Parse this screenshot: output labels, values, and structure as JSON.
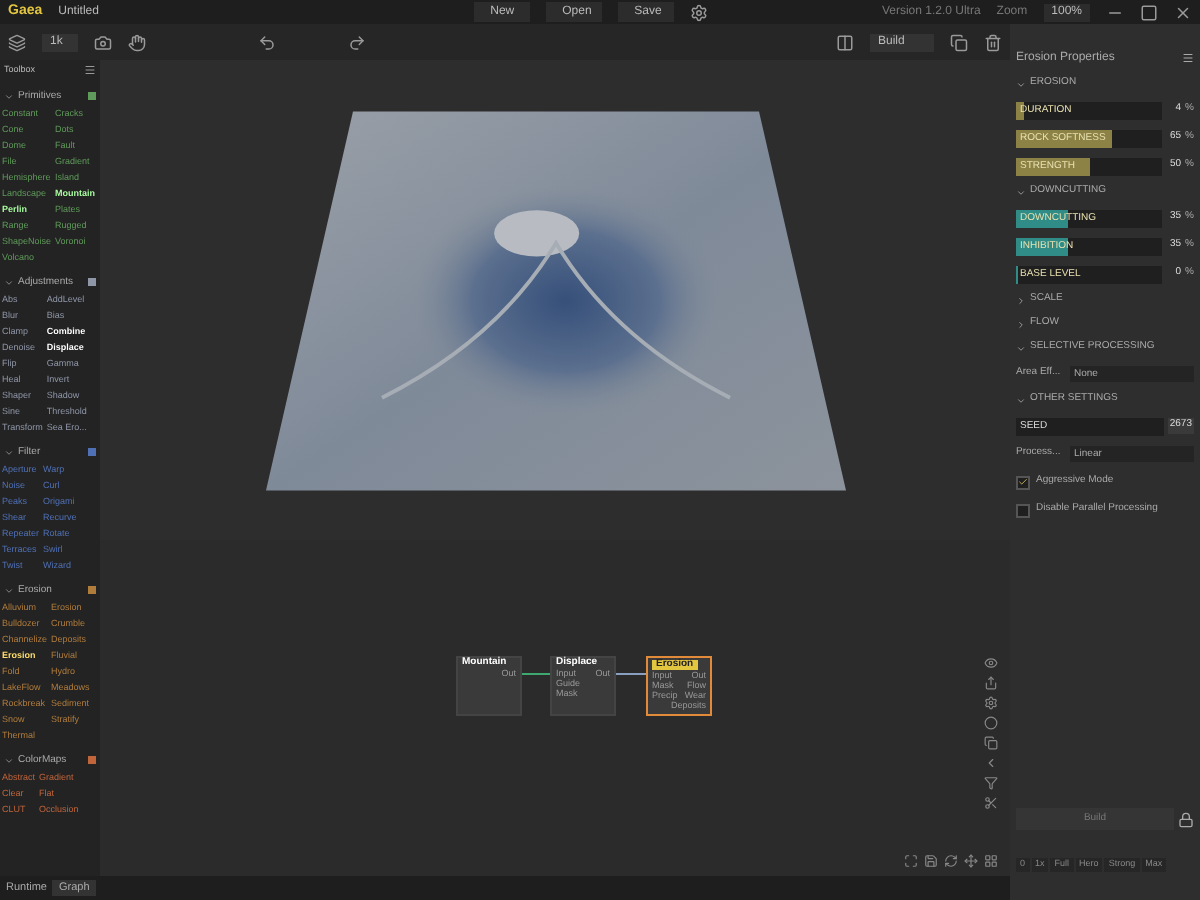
{
  "title_bar": {
    "app_name": "Gaea",
    "document": "Untitled",
    "buttons": [
      "New",
      "Open",
      "Save"
    ],
    "version": "Version 1.2.0 Ultra",
    "zoom_label": "Zoom",
    "zoom_value": "100%"
  },
  "toolbar": {
    "resolution": "1k",
    "view_mode": "Build"
  },
  "toolbox": {
    "title": "Toolbox",
    "sections": [
      {
        "name": "Primitives",
        "color": "#5f9a5a",
        "items": [
          {
            "label": "Constant",
            "in_use": false
          },
          {
            "label": "Cracks",
            "in_use": false
          },
          {
            "label": "Cone",
            "in_use": false
          },
          {
            "label": "Dots",
            "in_use": false
          },
          {
            "label": "Dome",
            "in_use": false
          },
          {
            "label": "Fault",
            "in_use": false
          },
          {
            "label": "File",
            "in_use": false
          },
          {
            "label": "Gradient",
            "in_use": false
          },
          {
            "label": "Hemisphere",
            "in_use": false
          },
          {
            "label": "Island",
            "in_use": false
          },
          {
            "label": "Landscape",
            "in_use": false
          },
          {
            "label": "Mountain",
            "in_use": true
          },
          {
            "label": "Perlin",
            "in_use": true
          },
          {
            "label": "Plates",
            "in_use": false
          },
          {
            "label": "Range",
            "in_use": false
          },
          {
            "label": "Rugged",
            "in_use": false
          },
          {
            "label": "ShapeNoise",
            "in_use": false
          },
          {
            "label": "Voronoi",
            "in_use": false
          },
          {
            "label": "Volcano",
            "in_use": false
          }
        ]
      },
      {
        "name": "Adjustments",
        "color": "#8f96a8",
        "items": [
          {
            "label": "Abs",
            "in_use": false
          },
          {
            "label": "AddLevel",
            "in_use": false
          },
          {
            "label": "Blur",
            "in_use": false
          },
          {
            "label": "Bias",
            "in_use": false
          },
          {
            "label": "Clamp",
            "in_use": false
          },
          {
            "label": "Combine",
            "in_use": true
          },
          {
            "label": "Denoise",
            "in_use": false
          },
          {
            "label": "Displace",
            "in_use": true
          },
          {
            "label": "Flip",
            "in_use": false
          },
          {
            "label": "Gamma",
            "in_use": false
          },
          {
            "label": "Heal",
            "in_use": false
          },
          {
            "label": "Invert",
            "in_use": false
          },
          {
            "label": "Shaper",
            "in_use": false
          },
          {
            "label": "Shadow",
            "in_use": false
          },
          {
            "label": "Sine",
            "in_use": false
          },
          {
            "label": "Threshold",
            "in_use": false
          },
          {
            "label": "Transform",
            "in_use": false
          },
          {
            "label": "Sea Ero...",
            "in_use": false
          }
        ]
      },
      {
        "name": "Filter",
        "color": "#4f70b5",
        "items": [
          {
            "label": "Aperture",
            "in_use": false
          },
          {
            "label": "Warp",
            "in_use": false
          },
          {
            "label": "Noise",
            "in_use": false
          },
          {
            "label": "Curl",
            "in_use": false
          },
          {
            "label": "Peaks",
            "in_use": false
          },
          {
            "label": "Origami",
            "in_use": false
          },
          {
            "label": "Shear",
            "in_use": false
          },
          {
            "label": "Recurve",
            "in_use": false
          },
          {
            "label": "Repeater",
            "in_use": false
          },
          {
            "label": "Rotate",
            "in_use": false
          },
          {
            "label": "Terraces",
            "in_use": false
          },
          {
            "label": "Swirl",
            "in_use": false
          },
          {
            "label": "Twist",
            "in_use": false
          },
          {
            "label": "Wizard",
            "in_use": false
          }
        ]
      },
      {
        "name": "Erosion",
        "color": "#b07c3c",
        "items": [
          {
            "label": "Alluvium",
            "in_use": false
          },
          {
            "label": "Erosion",
            "in_use": false
          },
          {
            "label": "Bulldozer",
            "in_use": false
          },
          {
            "label": "Crumble",
            "in_use": false
          },
          {
            "label": "Channelize",
            "in_use": false
          },
          {
            "label": "Deposits",
            "in_use": false
          },
          {
            "label": "Erosion",
            "in_use": true
          },
          {
            "label": "Fluvial",
            "in_use": false
          },
          {
            "label": "Fold",
            "in_use": false
          },
          {
            "label": "Hydro",
            "in_use": false
          },
          {
            "label": "LakeFlow",
            "in_use": false
          },
          {
            "label": "Meadows",
            "in_use": false
          },
          {
            "label": "Rockbreak",
            "in_use": false
          },
          {
            "label": "Sediment",
            "in_use": false
          },
          {
            "label": "Snow",
            "in_use": false
          },
          {
            "label": "Stratify",
            "in_use": false
          },
          {
            "label": "Thermal",
            "in_use": false
          }
        ]
      },
      {
        "name": "ColorMaps",
        "color": "#c0643a",
        "items": [
          {
            "label": "Abstract",
            "in_use": false
          },
          {
            "label": "Gradient",
            "in_use": false
          },
          {
            "label": "Clear",
            "in_use": false
          },
          {
            "label": "Flat",
            "in_use": false
          },
          {
            "label": "CLUT",
            "in_use": false
          },
          {
            "label": "Occlusion",
            "in_use": false
          }
        ]
      }
    ]
  },
  "graph": {
    "nodes": [
      {
        "title": "Mountain",
        "selected": false,
        "outputs": [
          "Out"
        ]
      },
      {
        "title": "Displace",
        "selected": false,
        "inputs": [
          "Input",
          "Guide",
          "Mask"
        ],
        "outputs": [
          "Out"
        ]
      },
      {
        "title": "Erosion",
        "selected": true,
        "inputs": [
          "Input",
          "Mask",
          "Precip"
        ],
        "outputs": [
          "Out",
          "Flow",
          "Wear",
          "Deposits"
        ]
      }
    ]
  },
  "status_bar": {
    "label": "Runtime",
    "value": "Graph"
  },
  "properties": {
    "title": "Erosion Properties",
    "sections": [
      {
        "name": "EROSION",
        "expanded": true,
        "color": "#8c8246",
        "sliders": [
          {
            "label": "DURATION",
            "level": 0.04,
            "value": "4",
            "unit": "%"
          },
          {
            "label": "ROCK SOFTNESS",
            "level": 0.65,
            "value": "65",
            "unit": "%"
          },
          {
            "label": "STRENGTH",
            "level": 0.5,
            "value": "50",
            "unit": "%"
          }
        ]
      },
      {
        "name": "DOWNCUTTING",
        "expanded": true,
        "color": "#2f8c86",
        "sliders": [
          {
            "label": "DOWNCUTTING",
            "level": 0.35,
            "value": "35",
            "unit": "%"
          },
          {
            "label": "INHIBITION",
            "level": 0.35,
            "value": "35",
            "unit": "%"
          },
          {
            "label": "BASE LEVEL",
            "level": 0,
            "value": "0",
            "unit": "%"
          }
        ]
      },
      {
        "name": "SCALE",
        "expanded": false
      },
      {
        "name": "FLOW",
        "expanded": false
      },
      {
        "name": "SELECTIVE PROCESSING",
        "expanded": true,
        "select": {
          "label": "Area Eff...",
          "value": "None"
        }
      },
      {
        "name": "OTHER SETTINGS",
        "expanded": true,
        "seed": {
          "label": "SEED",
          "value": "2673"
        },
        "select": {
          "label": "Process...",
          "value": "Linear"
        },
        "checkboxes": [
          {
            "label": "Aggressive Mode",
            "checked": true
          },
          {
            "label": "Disable Parallel Processing",
            "checked": false
          }
        ]
      }
    ],
    "build_button": "Build",
    "quality_tabs": [
      {
        "label": "0",
        "selected": false
      },
      {
        "label": "1x",
        "selected": false
      },
      {
        "label": "Full",
        "selected": false
      },
      {
        "label": "Hero",
        "selected": false
      },
      {
        "label": "Strong",
        "selected": false
      },
      {
        "label": "Max",
        "selected": false
      }
    ]
  }
}
